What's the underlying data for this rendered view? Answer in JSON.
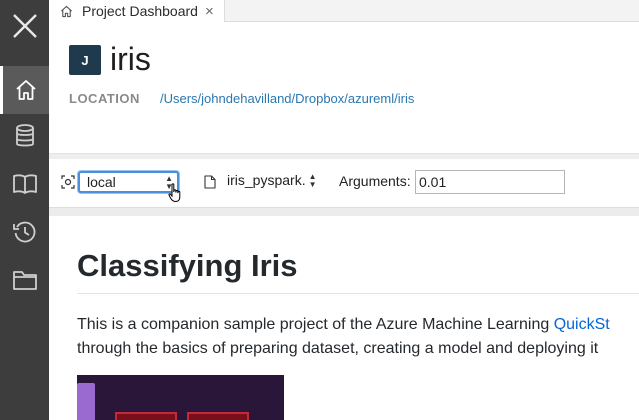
{
  "tabs": [
    {
      "label": "Project Dashboard",
      "icon": "home-icon",
      "active": true
    }
  ],
  "sidebar": {
    "items": [
      {
        "name": "home",
        "icon": "home-icon",
        "active": true
      },
      {
        "name": "data",
        "icon": "database-icon",
        "active": false
      },
      {
        "name": "notebooks",
        "icon": "book-icon",
        "active": false
      },
      {
        "name": "run-history",
        "icon": "history-icon",
        "active": false
      },
      {
        "name": "files",
        "icon": "folder-icon",
        "active": false
      }
    ]
  },
  "project": {
    "avatar_letter": "J",
    "name": "iris",
    "location_label": "LOCATION",
    "location_path": "/Users/johndehavilland/Dropbox/azureml/iris"
  },
  "toolbar": {
    "target_value": "local",
    "script_value": "iris_pyspark.",
    "arguments_label": "Arguments:",
    "arguments_value": "0.01"
  },
  "readme": {
    "title": "Classifying Iris",
    "line1_text": "This is a companion sample project of the Azure Machine Learning ",
    "line1_link": "QuickSt",
    "line2_text": "through the basics of preparing dataset, creating a model and deploying it"
  },
  "colors": {
    "sidebar_bg": "#3d3d3d",
    "avatar_bg": "#1e3a4c",
    "link": "#2a78b0",
    "focus_ring": "#4a90d9"
  }
}
